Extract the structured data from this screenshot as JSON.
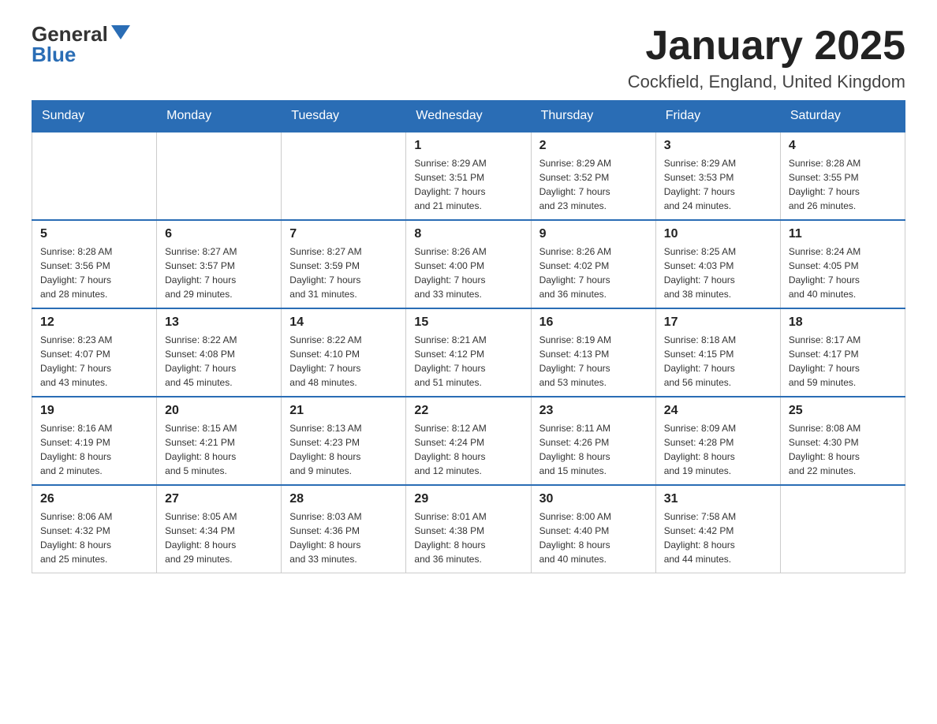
{
  "header": {
    "logo_general": "General",
    "logo_blue": "Blue",
    "month_title": "January 2025",
    "location": "Cockfield, England, United Kingdom"
  },
  "days_of_week": [
    "Sunday",
    "Monday",
    "Tuesday",
    "Wednesday",
    "Thursday",
    "Friday",
    "Saturday"
  ],
  "weeks": [
    [
      {
        "day": "",
        "info": ""
      },
      {
        "day": "",
        "info": ""
      },
      {
        "day": "",
        "info": ""
      },
      {
        "day": "1",
        "info": "Sunrise: 8:29 AM\nSunset: 3:51 PM\nDaylight: 7 hours\nand 21 minutes."
      },
      {
        "day": "2",
        "info": "Sunrise: 8:29 AM\nSunset: 3:52 PM\nDaylight: 7 hours\nand 23 minutes."
      },
      {
        "day": "3",
        "info": "Sunrise: 8:29 AM\nSunset: 3:53 PM\nDaylight: 7 hours\nand 24 minutes."
      },
      {
        "day": "4",
        "info": "Sunrise: 8:28 AM\nSunset: 3:55 PM\nDaylight: 7 hours\nand 26 minutes."
      }
    ],
    [
      {
        "day": "5",
        "info": "Sunrise: 8:28 AM\nSunset: 3:56 PM\nDaylight: 7 hours\nand 28 minutes."
      },
      {
        "day": "6",
        "info": "Sunrise: 8:27 AM\nSunset: 3:57 PM\nDaylight: 7 hours\nand 29 minutes."
      },
      {
        "day": "7",
        "info": "Sunrise: 8:27 AM\nSunset: 3:59 PM\nDaylight: 7 hours\nand 31 minutes."
      },
      {
        "day": "8",
        "info": "Sunrise: 8:26 AM\nSunset: 4:00 PM\nDaylight: 7 hours\nand 33 minutes."
      },
      {
        "day": "9",
        "info": "Sunrise: 8:26 AM\nSunset: 4:02 PM\nDaylight: 7 hours\nand 36 minutes."
      },
      {
        "day": "10",
        "info": "Sunrise: 8:25 AM\nSunset: 4:03 PM\nDaylight: 7 hours\nand 38 minutes."
      },
      {
        "day": "11",
        "info": "Sunrise: 8:24 AM\nSunset: 4:05 PM\nDaylight: 7 hours\nand 40 minutes."
      }
    ],
    [
      {
        "day": "12",
        "info": "Sunrise: 8:23 AM\nSunset: 4:07 PM\nDaylight: 7 hours\nand 43 minutes."
      },
      {
        "day": "13",
        "info": "Sunrise: 8:22 AM\nSunset: 4:08 PM\nDaylight: 7 hours\nand 45 minutes."
      },
      {
        "day": "14",
        "info": "Sunrise: 8:22 AM\nSunset: 4:10 PM\nDaylight: 7 hours\nand 48 minutes."
      },
      {
        "day": "15",
        "info": "Sunrise: 8:21 AM\nSunset: 4:12 PM\nDaylight: 7 hours\nand 51 minutes."
      },
      {
        "day": "16",
        "info": "Sunrise: 8:19 AM\nSunset: 4:13 PM\nDaylight: 7 hours\nand 53 minutes."
      },
      {
        "day": "17",
        "info": "Sunrise: 8:18 AM\nSunset: 4:15 PM\nDaylight: 7 hours\nand 56 minutes."
      },
      {
        "day": "18",
        "info": "Sunrise: 8:17 AM\nSunset: 4:17 PM\nDaylight: 7 hours\nand 59 minutes."
      }
    ],
    [
      {
        "day": "19",
        "info": "Sunrise: 8:16 AM\nSunset: 4:19 PM\nDaylight: 8 hours\nand 2 minutes."
      },
      {
        "day": "20",
        "info": "Sunrise: 8:15 AM\nSunset: 4:21 PM\nDaylight: 8 hours\nand 5 minutes."
      },
      {
        "day": "21",
        "info": "Sunrise: 8:13 AM\nSunset: 4:23 PM\nDaylight: 8 hours\nand 9 minutes."
      },
      {
        "day": "22",
        "info": "Sunrise: 8:12 AM\nSunset: 4:24 PM\nDaylight: 8 hours\nand 12 minutes."
      },
      {
        "day": "23",
        "info": "Sunrise: 8:11 AM\nSunset: 4:26 PM\nDaylight: 8 hours\nand 15 minutes."
      },
      {
        "day": "24",
        "info": "Sunrise: 8:09 AM\nSunset: 4:28 PM\nDaylight: 8 hours\nand 19 minutes."
      },
      {
        "day": "25",
        "info": "Sunrise: 8:08 AM\nSunset: 4:30 PM\nDaylight: 8 hours\nand 22 minutes."
      }
    ],
    [
      {
        "day": "26",
        "info": "Sunrise: 8:06 AM\nSunset: 4:32 PM\nDaylight: 8 hours\nand 25 minutes."
      },
      {
        "day": "27",
        "info": "Sunrise: 8:05 AM\nSunset: 4:34 PM\nDaylight: 8 hours\nand 29 minutes."
      },
      {
        "day": "28",
        "info": "Sunrise: 8:03 AM\nSunset: 4:36 PM\nDaylight: 8 hours\nand 33 minutes."
      },
      {
        "day": "29",
        "info": "Sunrise: 8:01 AM\nSunset: 4:38 PM\nDaylight: 8 hours\nand 36 minutes."
      },
      {
        "day": "30",
        "info": "Sunrise: 8:00 AM\nSunset: 4:40 PM\nDaylight: 8 hours\nand 40 minutes."
      },
      {
        "day": "31",
        "info": "Sunrise: 7:58 AM\nSunset: 4:42 PM\nDaylight: 8 hours\nand 44 minutes."
      },
      {
        "day": "",
        "info": ""
      }
    ]
  ]
}
